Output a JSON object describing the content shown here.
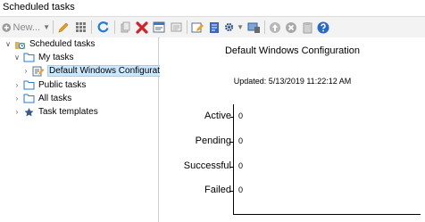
{
  "window": {
    "title": "Scheduled tasks"
  },
  "toolbar": {
    "new_label": "New..."
  },
  "tree": {
    "root": "Scheduled tasks",
    "my_tasks": "My tasks",
    "default_config": "Default Windows Configuration",
    "public_tasks": "Public tasks",
    "all_tasks": "All tasks",
    "task_templates": "Task templates"
  },
  "chart_data": {
    "type": "bar",
    "title": "Default Windows Configuration",
    "subtitle": "Updated: 5/13/2019 11:22:12 AM",
    "categories": [
      "Active",
      "Pending",
      "Successful",
      "Failed"
    ],
    "values": [
      0,
      0,
      0,
      0
    ],
    "value_labels": [
      "0",
      "0",
      "0",
      "0"
    ],
    "orientation": "horizontal"
  },
  "colors": {
    "accent_blue": "#1e7bd6",
    "selection": "#cce8ff",
    "delete_red": "#d3202a",
    "folder_yellow": "#dcb35c"
  }
}
